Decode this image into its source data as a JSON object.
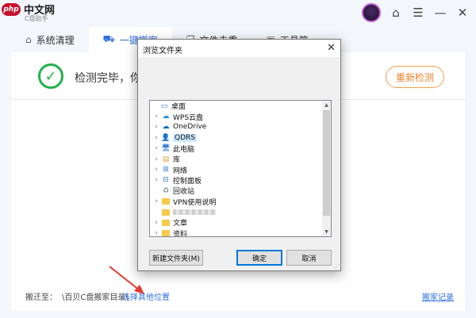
{
  "app": {
    "logo_mark": "php",
    "logo_site": "中文网",
    "name": "C盘助手"
  },
  "tabs": [
    {
      "label": "系统清理",
      "icon": "home-icon",
      "active": false
    },
    {
      "label": "一键搬家",
      "icon": "truck-icon",
      "active": true
    },
    {
      "label": "文件去重",
      "icon": "files-icon",
      "active": false
    },
    {
      "label": "工具箱",
      "icon": "toolbox-icon",
      "active": false
    }
  ],
  "status": {
    "text": "检测完毕，你",
    "recheck_label": "重新检测"
  },
  "bottom": {
    "move_label": "搬迁至：",
    "move_path": "\\百贝C盘搬家目录\\",
    "choose_label": "选择其他位置",
    "history_label": "搬家记录"
  },
  "dialog": {
    "title": "浏览文件夹",
    "tree": [
      {
        "label": "桌面",
        "icon": "desktop-icon",
        "expandable": false,
        "selected": false,
        "indent": 0
      },
      {
        "label": "WPS云盘",
        "icon": "cloud-icon",
        "expandable": true,
        "selected": false,
        "indent": 1
      },
      {
        "label": "OneDrive",
        "icon": "onedrive-icon",
        "expandable": true,
        "selected": false,
        "indent": 1
      },
      {
        "label": "QDRS",
        "icon": "user-icon",
        "expandable": true,
        "selected": true,
        "indent": 1
      },
      {
        "label": "此电脑",
        "icon": "computer-icon",
        "expandable": true,
        "selected": false,
        "indent": 1
      },
      {
        "label": "库",
        "icon": "library-icon",
        "expandable": true,
        "selected": false,
        "indent": 1
      },
      {
        "label": "网络",
        "icon": "network-icon",
        "expandable": true,
        "selected": false,
        "indent": 1
      },
      {
        "label": "控制面板",
        "icon": "control-panel-icon",
        "expandable": true,
        "selected": false,
        "indent": 1
      },
      {
        "label": "回收站",
        "icon": "recycle-bin-icon",
        "expandable": false,
        "selected": false,
        "indent": 1
      },
      {
        "label": "VPN使用说明",
        "icon": "folder-icon",
        "expandable": true,
        "selected": false,
        "indent": 1
      },
      {
        "label": "",
        "icon": "folder-icon",
        "expandable": false,
        "selected": false,
        "indent": 1,
        "blurred": true
      },
      {
        "label": "文章",
        "icon": "folder-icon",
        "expandable": true,
        "selected": false,
        "indent": 1
      },
      {
        "label": "资料",
        "icon": "folder-icon",
        "expandable": true,
        "selected": false,
        "indent": 1
      }
    ],
    "new_folder_label": "新建文件夹(M)",
    "ok_label": "确定",
    "cancel_label": "取消"
  },
  "colors": {
    "accent": "#2f6fe0",
    "success": "#21b24b",
    "orange": "#e8842a",
    "arrow": "#e53935"
  }
}
